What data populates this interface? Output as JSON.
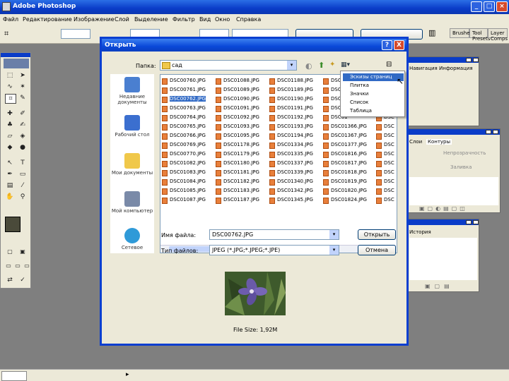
{
  "app": {
    "title": "Adobe Photoshop"
  },
  "menu": [
    "Файл",
    "Редактирование",
    "Изображение",
    "Слой",
    "Выделение",
    "Фильтр",
    "Вид",
    "Окно",
    "Справка"
  ],
  "palette_tabs": [
    "Brushes",
    "Tool Presets",
    "Layer Comps"
  ],
  "layers_panel": {
    "tab_contours": "Контуры",
    "tab_layers": "Слои",
    "opacity_label": "Непрозрачность",
    "fill_label": "Заливка"
  },
  "history_panel": {
    "tab": "История"
  },
  "navigator_panel": {
    "tab_navigator": "Навигация",
    "tab_info": "Информация"
  },
  "dialog": {
    "title": "Открыть",
    "help": "?",
    "close": "X",
    "look_in_label": "Папка:",
    "look_in_value": "сад",
    "places": [
      "Недавние документы",
      "Рабочий стол",
      "Мои документы",
      "Мой компьютер",
      "Сетевое"
    ],
    "files": [
      [
        "DSC00760.JPG",
        "DSC00761.JPG",
        "DSC00762.JPG",
        "DSC00763.JPG",
        "DSC00764.JPG",
        "DSC00765.JPG",
        "DSC00766.JPG",
        "DSC00769.JPG",
        "DSC00770.JPG",
        "DSC01082.JPG",
        "DSC01083.JPG",
        "DSC01084.JPG",
        "DSC01085.JPG",
        "DSC01087.JPG"
      ],
      [
        "DSC01088.JPG",
        "DSC01089.JPG",
        "DSC01090.JPG",
        "DSC01091.JPG",
        "DSC01092.JPG",
        "DSC01093.JPG",
        "DSC01095.JPG",
        "DSC01178.JPG",
        "DSC01179.JPG",
        "DSC01180.JPG",
        "DSC01181.JPG",
        "DSC01182.JPG",
        "DSC01183.JPG",
        "DSC01187.JPG"
      ],
      [
        "DSC01188.JPG",
        "DSC01189.JPG",
        "DSC01190.JPG",
        "DSC01191.JPG",
        "DSC01192.JPG",
        "DSC01193.JPG",
        "DSC01194.JPG",
        "DSC01334.JPG",
        "DSC01335.JPG",
        "DSC01337.JPG",
        "DSC01339.JPG",
        "DSC01340.JPG",
        "DSC01342.JPG",
        "DSC01345.JPG"
      ],
      [
        "DSC01",
        "DSC01",
        "DSC01",
        "DSC01",
        "DSC01",
        "DSC01366.JPG",
        "DSC01367.JPG",
        "DSC01377.JPG",
        "DSC01816.JPG",
        "DSC01817.JPG",
        "DSC01818.JPG",
        "DSC01819.JPG",
        "DSC01820.JPG",
        "DSC01824.JPG"
      ],
      [
        "DSC",
        "DSC",
        "DSC",
        "DSC",
        "DSC",
        "DSC",
        "DSC",
        "DSC",
        "DSC",
        "DSC",
        "DSC",
        "DSC",
        "DSC",
        "DSC"
      ]
    ],
    "selected_file": "DSC00762.JPG",
    "filename_label": "Имя файла:",
    "filename_value": "DSC00762.JPG",
    "filetype_label": "Тип файлов:",
    "filetype_value": "JPEG (*.JPG;*.JPEG;*.JPE)",
    "open_button": "Открыть",
    "cancel_button": "Отмена",
    "file_size": "File Size: 1,92M"
  },
  "view_menu": {
    "items": [
      "Эскизы страниц",
      "Плитка",
      "Значки",
      "Список",
      "Таблица"
    ],
    "selected_index": 0
  }
}
